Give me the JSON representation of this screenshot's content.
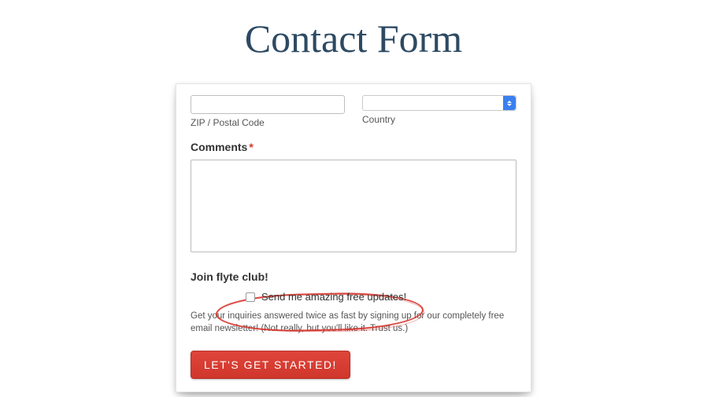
{
  "title": "Contact Form",
  "form": {
    "zip": {
      "value": "",
      "label": "ZIP / Postal Code"
    },
    "country": {
      "value": "",
      "label": "Country"
    },
    "comments": {
      "label": "Comments",
      "required_mark": "*",
      "value": ""
    },
    "newsletter": {
      "heading": "Join flyte club!",
      "checkbox_label": "Send me amazing free updates!",
      "checked": false,
      "helper": "Get your inquiries answered twice as fast by signing up for our completely free email newsletter! (Not really, but you'll like it. Trust us.)"
    },
    "submit_label": "LET'S GET STARTED!"
  },
  "colors": {
    "title": "#2d4a63",
    "accent_red": "#d6342b",
    "select_arrow_bg": "#3a7ff0"
  }
}
